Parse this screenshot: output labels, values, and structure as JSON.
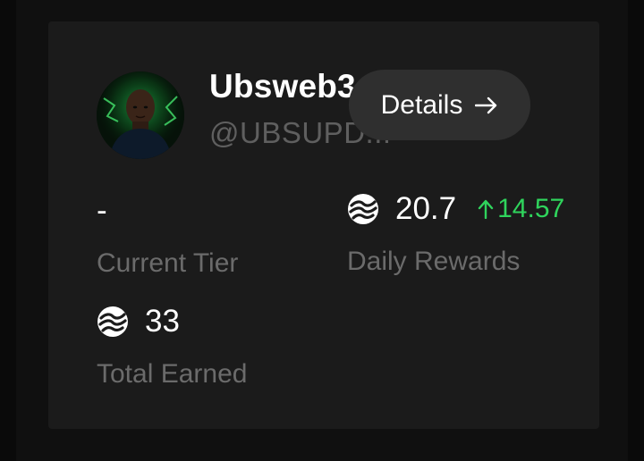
{
  "profile": {
    "display_name": "Ubsweb3",
    "handle": "@UBSUPD..."
  },
  "details_button": {
    "label": "Details",
    "icon": "arrow-right-icon"
  },
  "stats": {
    "current_tier": {
      "value": "-",
      "label": "Current Tier"
    },
    "daily_rewards": {
      "value": "20.7",
      "delta": "14.57",
      "delta_icon": "arrow-up-icon",
      "label": "Daily Rewards",
      "icon": "token-icon"
    },
    "total_earned": {
      "value": "33",
      "label": "Total Earned",
      "icon": "token-icon"
    }
  },
  "colors": {
    "card_background": "#1b1b1b",
    "button_background": "#2f2f2f",
    "positive": "#2fd45c",
    "muted_text": "#6b6b6b"
  }
}
